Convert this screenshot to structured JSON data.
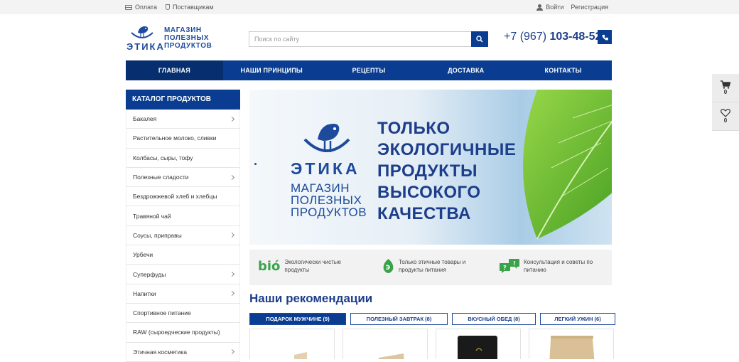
{
  "topbar": {
    "payment": "Оплата",
    "suppliers": "Поставщикам",
    "login": "Войти",
    "register": "Регистрация"
  },
  "header": {
    "brand": "ЭТИКА",
    "slogan_line1": "МАГАЗИН",
    "slogan_line2": "ПОЛЕЗНЫХ",
    "slogan_line3": "ПРОДУКТОВ",
    "search_placeholder": "Поиск по сайту",
    "phone_prefix": "+7 (967) ",
    "phone_number": "103-48-52"
  },
  "nav": {
    "items": [
      {
        "label": "ГЛАВНАЯ",
        "active": true
      },
      {
        "label": "НАШИ ПРИНЦИПЫ",
        "active": false
      },
      {
        "label": "РЕЦЕПТЫ",
        "active": false
      },
      {
        "label": "ДОСТАВКА",
        "active": false
      },
      {
        "label": "КОНТАКТЫ",
        "active": false
      }
    ]
  },
  "catalog": {
    "title": "КАТАЛОГ ПРОДУКТОВ",
    "items": [
      {
        "label": "Бакалея",
        "has_children": true
      },
      {
        "label": "Растительное молоко, сливки",
        "has_children": false
      },
      {
        "label": "Колбасы, сыры, тофу",
        "has_children": false
      },
      {
        "label": "Полезные сладости",
        "has_children": true
      },
      {
        "label": "Бездрожжевой хлеб и хлебцы",
        "has_children": false
      },
      {
        "label": "Травяной чай",
        "has_children": false
      },
      {
        "label": "Соусы, приправы",
        "has_children": true
      },
      {
        "label": "Урбечи",
        "has_children": false
      },
      {
        "label": "Суперфуды",
        "has_children": true
      },
      {
        "label": "Напитки",
        "has_children": true
      },
      {
        "label": "Спортивное питание",
        "has_children": false
      },
      {
        "label": "RAW (сыроедческие продукты)",
        "has_children": false
      },
      {
        "label": "Этичная косметика",
        "has_children": true
      }
    ]
  },
  "banner": {
    "brand": "ЭТИКА",
    "slogan_line1": "МАГАЗИН",
    "slogan_line2": "ПОЛЕЗНЫХ",
    "slogan_line3": "ПРОДУКТОВ",
    "headline_line1": "ТОЛЬКО",
    "headline_line2": "ЭКОЛОГИЧНЫЕ",
    "headline_line3": "ПРОДУКТЫ",
    "headline_line4": "ВЫСОКОГО",
    "headline_line5": "КАЧЕСТВА"
  },
  "features": {
    "bio_logo": "bió",
    "f1_line1": "Экологически чистые",
    "f1_line2": "продукты",
    "f2_line1": "Только этичные товары и",
    "f2_line2": "продукты питания",
    "f3_line1": "Консультация и советы по",
    "f3_line2": "питанию"
  },
  "recommendations": {
    "title": "Наши рекомендации",
    "tabs": [
      {
        "label": "ПОДАРОК МУЖЧИНЕ (9)",
        "active": true
      },
      {
        "label": "ПОЛЕЗНЫЙ ЗАВТРАК (8)",
        "active": false
      },
      {
        "label": "ВКУСНЫЙ ОБЕД (8)",
        "active": false
      },
      {
        "label": "ЛЕГКИЙ УЖИН (6)",
        "active": false
      }
    ]
  },
  "sidewidget": {
    "cart_count": "0",
    "wishlist_count": "0"
  },
  "colors": {
    "primary": "#0a3d91",
    "nav_active": "#072f70",
    "green": "#3aa34a"
  }
}
